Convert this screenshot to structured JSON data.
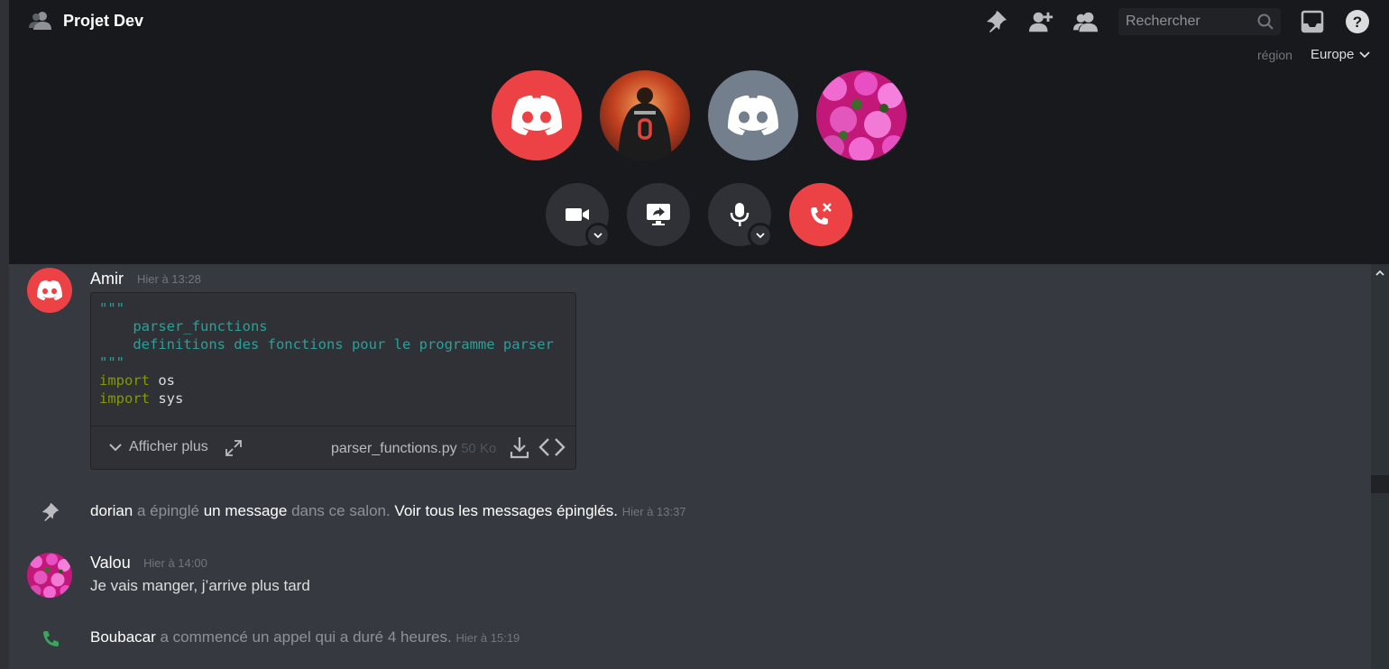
{
  "header": {
    "title": "Projet Dev",
    "search_placeholder": "Rechercher",
    "region_label": "région",
    "region_value": "Europe",
    "icons": [
      "group-icon",
      "pin-icon",
      "add-member-icon",
      "members-icon",
      "search-icon",
      "inbox-icon",
      "help-icon"
    ]
  },
  "call": {
    "participants": [
      "discord-red",
      "basketball-player",
      "discord-grey",
      "pink-flowers"
    ],
    "controls": [
      "camera",
      "screen-share",
      "microphone",
      "hang-up"
    ]
  },
  "colors": {
    "brand_red": "#ed4245",
    "grey_avatar": "#747f8d",
    "call_bg": "#18191c",
    "chat_bg": "#36393f",
    "online_green": "#3ba55d"
  },
  "messages": {
    "amir": {
      "author": "Amir",
      "timestamp": "Hier à 13:28",
      "code_lines": [
        {
          "cls": "str",
          "text": "\"\"\""
        },
        {
          "cls": "str",
          "text": "    parser_functions"
        },
        {
          "cls": "str",
          "text": "    definitions des fonctions pour le programme parser"
        },
        {
          "cls": "str",
          "text": "\"\"\""
        },
        {
          "cls": "kw",
          "kw": "import",
          "rest": " os"
        },
        {
          "cls": "kw",
          "kw": "import",
          "rest": " sys"
        }
      ],
      "show_more": "Afficher plus",
      "filename": "parser_functions.py",
      "filesize": "50 Ko"
    },
    "pin_notice": {
      "user": "dorian",
      "part1": " a épinglé ",
      "link1": "un message",
      "part2": " dans ce salon. ",
      "link2": "Voir tous les messages épinglés.",
      "timestamp": "Hier à 13:37"
    },
    "valou": {
      "author": "Valou",
      "timestamp": "Hier à 14:00",
      "text": "Je vais manger, j’arrive plus tard"
    },
    "call_notice": {
      "user": "Boubacar",
      "text": " a commencé un appel qui a duré 4 heures.",
      "timestamp": "Hier à 15:19"
    }
  }
}
